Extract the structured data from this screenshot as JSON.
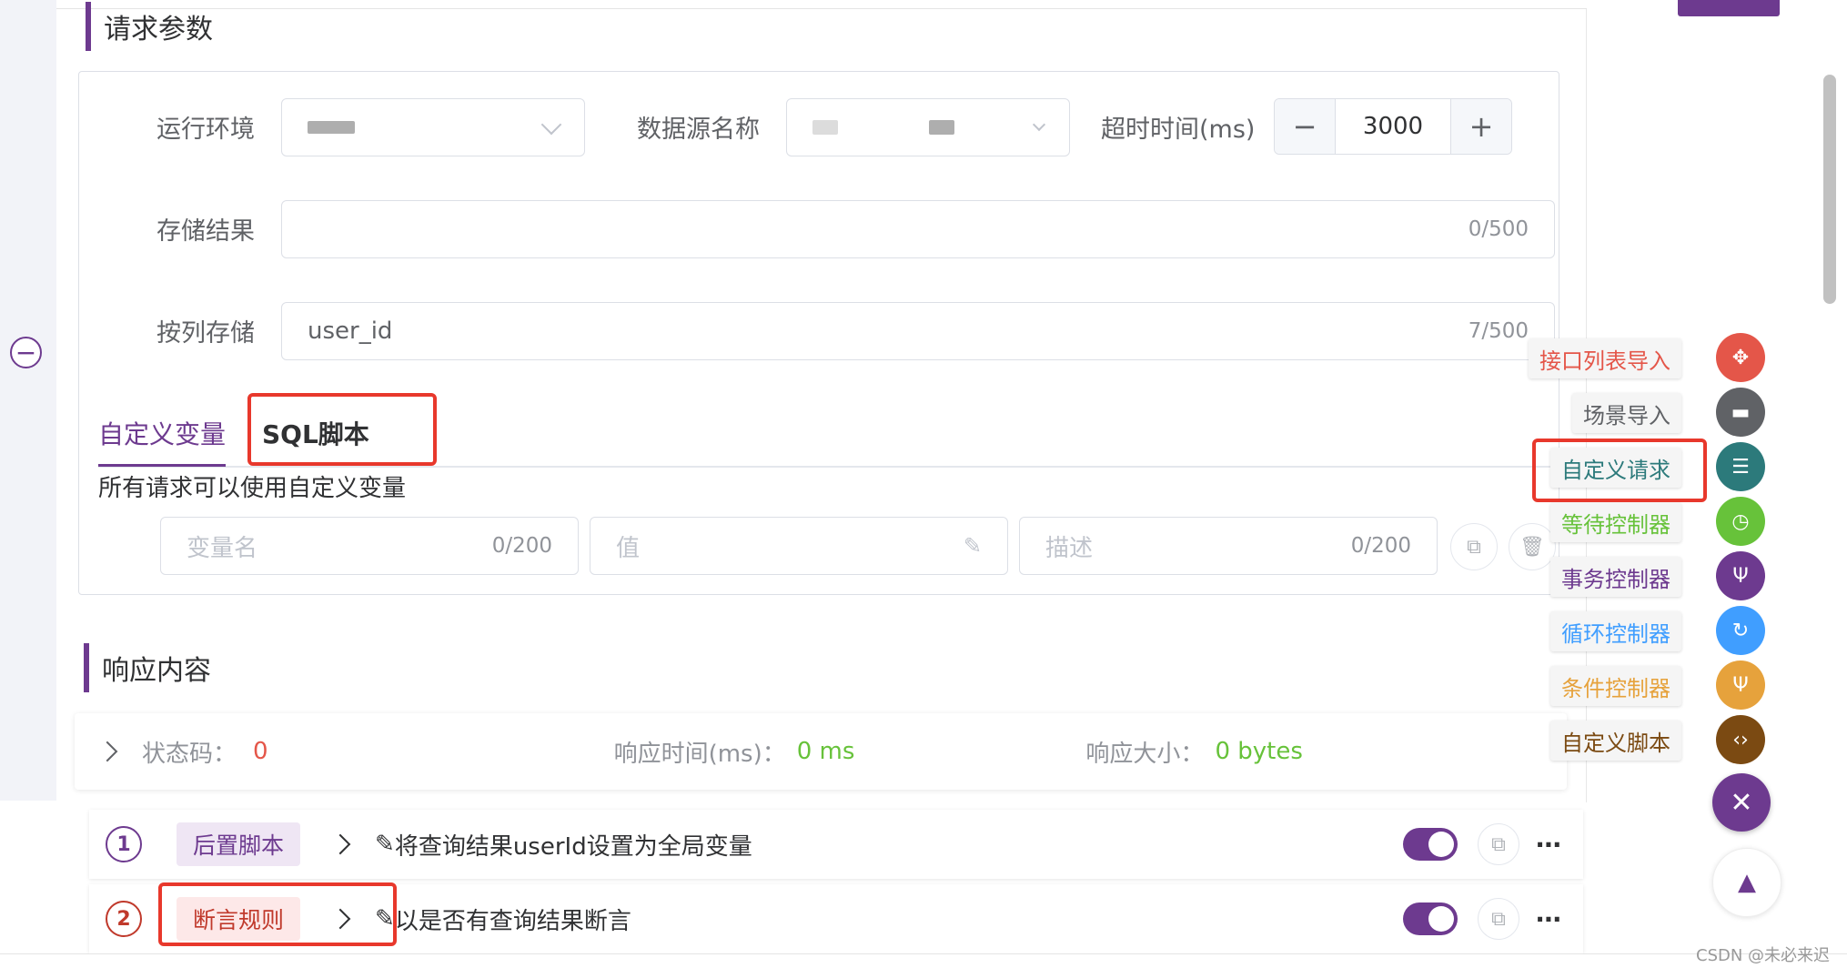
{
  "request_params": {
    "title": "请求参数",
    "env_label": "运行环境",
    "datasource_label": "数据源名称",
    "timeout_label": "超时时间(ms)",
    "timeout_value": "3000",
    "timeout_minus": "−",
    "timeout_plus": "+",
    "store_result_label": "存储结果",
    "store_result_value": "",
    "store_result_counter": "0/500",
    "store_by_column_label": "按列存储",
    "store_by_column_value": "user_id",
    "store_by_column_counter": "7/500"
  },
  "tabs": {
    "custom_vars": "自定义变量",
    "sql_script": "SQL脚本"
  },
  "custom_vars": {
    "hint": "所有请求可以使用自定义变量",
    "name_placeholder": "变量名",
    "name_counter": "0/200",
    "value_placeholder": "值",
    "desc_placeholder": "描述",
    "desc_counter": "0/200"
  },
  "response": {
    "title": "响应内容",
    "status_label": "状态码：",
    "status_value": "0",
    "time_label": "响应时间(ms)：",
    "time_value": "0 ms",
    "size_label": "响应大小：",
    "size_value": "0 bytes"
  },
  "steps": [
    {
      "index": "1",
      "tag": "后置脚本",
      "desc": "将查询结果userId设置为全局变量"
    },
    {
      "index": "2",
      "tag": "断言规则",
      "desc": "以是否有查询结果断言"
    }
  ],
  "float_menu": [
    {
      "label": "接口列表导入",
      "color": "#e45649",
      "icon": "api-import-icon"
    },
    {
      "label": "场景导入",
      "color": "#606266",
      "icon": "scene-import-icon"
    },
    {
      "label": "自定义请求",
      "color": "#2c7a7b",
      "icon": "custom-request-icon"
    },
    {
      "label": "等待控制器",
      "color": "#67c23a",
      "icon": "clock-icon"
    },
    {
      "label": "事务控制器",
      "color": "#6d3a8f",
      "icon": "transaction-icon"
    },
    {
      "label": "循环控制器",
      "color": "#409eff",
      "icon": "loop-icon"
    },
    {
      "label": "条件控制器",
      "color": "#e6a23c",
      "icon": "condition-icon"
    },
    {
      "label": "自定义脚本",
      "color": "#7b4a12",
      "icon": "code-icon"
    }
  ],
  "watermark": "CSDN @未必来迟",
  "colors": {
    "accent": "#6d3a8f",
    "highlight_box": "#e8382c"
  }
}
